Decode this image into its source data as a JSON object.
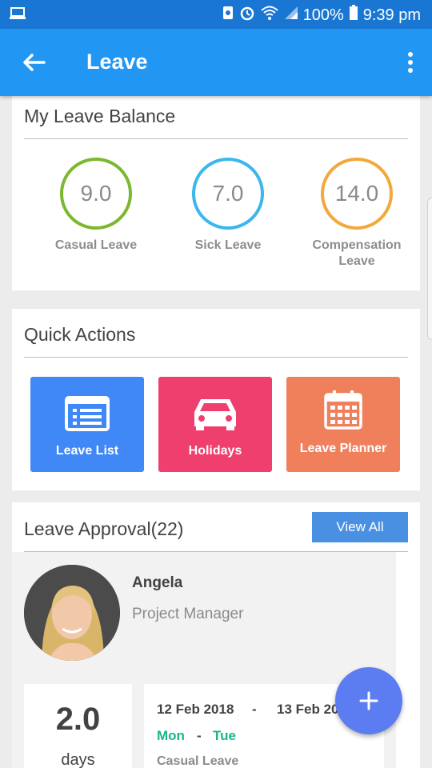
{
  "status_bar": {
    "battery": "100%",
    "time": "9:39 pm",
    "icons": [
      "laptop-icon",
      "sync-icon",
      "alarm-icon",
      "wifi-icon",
      "signal-icon",
      "battery-icon"
    ]
  },
  "app_bar": {
    "title": "Leave",
    "back_icon": "arrow-left-icon",
    "menu_icon": "more-vertical-icon"
  },
  "balance": {
    "title": "My Leave Balance",
    "items": [
      {
        "value": "9.0",
        "label": "Casual Leave",
        "color": "#7cb82f"
      },
      {
        "value": "7.0",
        "label": "Sick Leave",
        "color": "#3bb7ee"
      },
      {
        "value": "14.0",
        "label": "Compensation Leave",
        "color": "#f2a93b"
      }
    ]
  },
  "quick_actions": {
    "title": "Quick Actions",
    "items": [
      {
        "label": "Leave List",
        "icon": "list-icon",
        "color": "#3f88f5"
      },
      {
        "label": "Holidays",
        "icon": "car-icon",
        "color": "#ef3f6e"
      },
      {
        "label": "Leave Planner",
        "icon": "calendar-icon",
        "color": "#f07f5c"
      }
    ]
  },
  "approval": {
    "title": "Leave Approval(22)",
    "view_all": "View All",
    "request": {
      "name": "Angela",
      "role": "Project Manager",
      "days_value": "2.0",
      "days_label": "days",
      "from_date": "12 Feb 2018",
      "date_separator": "-",
      "to_date": "13 Feb 2018",
      "from_day": "Mon",
      "day_separator": "-",
      "to_day": "Tue",
      "leave_type": "Casual Leave"
    }
  },
  "fab": {
    "label": "+",
    "icon": "plus-icon"
  },
  "colors": {
    "status_bar": "#1976d2",
    "app_bar": "#2196f3",
    "view_all": "#4a90e2",
    "day_highlight": "#1cb48a",
    "fab": "#5c7cf2"
  }
}
